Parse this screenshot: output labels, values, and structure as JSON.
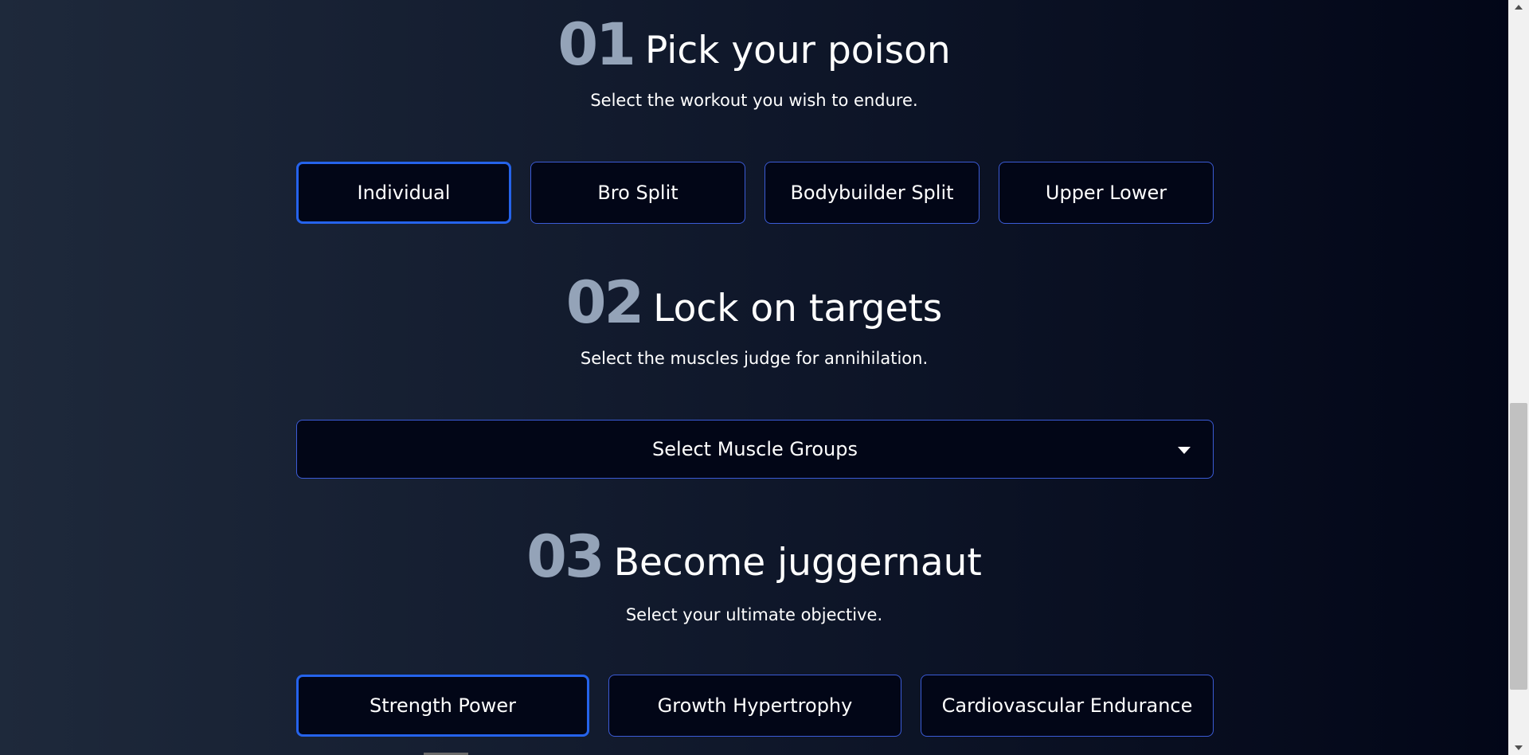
{
  "sections": [
    {
      "number": "01",
      "title": "Pick your poison",
      "subtitle": "Select the workout you wish to endure.",
      "options": [
        {
          "label": "Individual",
          "selected": true
        },
        {
          "label": "Bro Split",
          "selected": false
        },
        {
          "label": "Bodybuilder Split",
          "selected": false
        },
        {
          "label": "Upper Lower",
          "selected": false
        }
      ]
    },
    {
      "number": "02",
      "title": "Lock on targets",
      "subtitle": "Select the muscles judge for annihilation.",
      "dropdown": {
        "label": "Select Muscle Groups",
        "icon": "caret-down-icon"
      }
    },
    {
      "number": "03",
      "title": "Become juggernaut",
      "subtitle": "Select your ultimate objective.",
      "options": [
        {
          "label": "Strength Power",
          "selected": true
        },
        {
          "label": "Growth Hypertrophy",
          "selected": false
        },
        {
          "label": "Cardiovascular Endurance",
          "selected": false
        }
      ]
    }
  ],
  "colors": {
    "number": "#94a3b8",
    "button_bg": "#020617",
    "button_border": "#3b5bd6",
    "selected_border": "#2563eb",
    "background_start": "#1e293b",
    "background_end": "#020617"
  }
}
